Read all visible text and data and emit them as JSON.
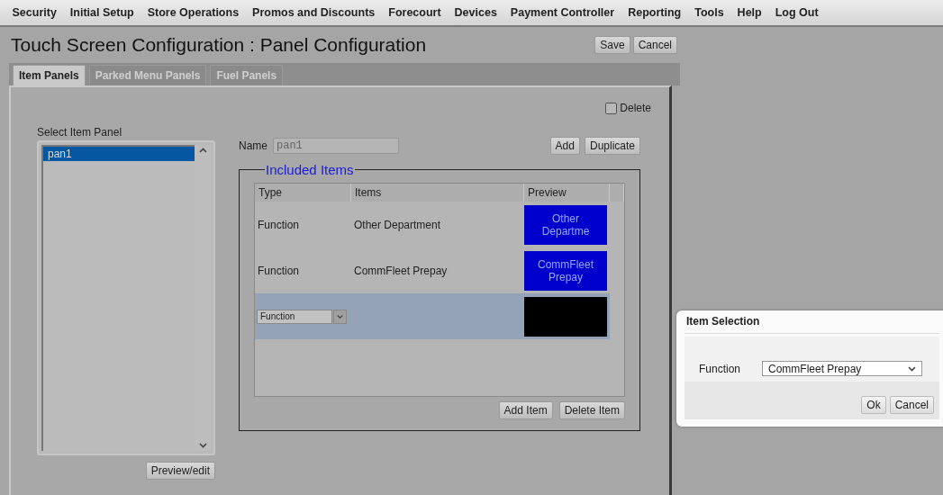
{
  "menu": [
    "Security",
    "Initial Setup",
    "Store Operations",
    "Promos and Discounts",
    "Forecourt",
    "Devices",
    "Payment Controller",
    "Reporting",
    "Tools",
    "Help",
    "Log Out"
  ],
  "title": "Touch Screen Configuration : Panel Configuration",
  "header_buttons": [
    "Save",
    "Cancel"
  ],
  "tabs": [
    {
      "label": "Item Panels",
      "selected": true
    },
    {
      "label": "Parked Menu Panels",
      "selected": false
    },
    {
      "label": "Fuel Panels",
      "selected": false
    }
  ],
  "delete_checkbox": {
    "label": "Delete",
    "checked": false
  },
  "item_panel_list": {
    "label": "Select Item Panel",
    "items": [
      {
        "label": "pan1",
        "selected": true
      }
    ]
  },
  "preview_button": "Preview/edit",
  "name_field": {
    "label": "Name",
    "value": "pan1"
  },
  "panel_buttons": [
    "Add",
    "Duplicate"
  ],
  "included_items": {
    "legend": "Included Items",
    "columns": [
      "Type",
      "Items",
      "Preview"
    ],
    "rows": [
      {
        "kind": "text",
        "type": "Function",
        "item": "Other Department",
        "preview": "Other Departme",
        "color": "#0000cc",
        "selected": false
      },
      {
        "kind": "text",
        "type": "Function",
        "item": "CommFleet Prepay",
        "preview": "CommFleet Prepay",
        "color": "#0000cc",
        "selected": false
      },
      {
        "kind": "editor",
        "type": "Function",
        "color": "#000000",
        "selected": true
      }
    ],
    "buttons": [
      "Add Item",
      "Delete Item"
    ]
  },
  "dialog": {
    "title": "Item Selection",
    "field_label": "Function",
    "value": "CommFleet Prepay",
    "buttons": [
      "Ok",
      "Cancel"
    ]
  }
}
